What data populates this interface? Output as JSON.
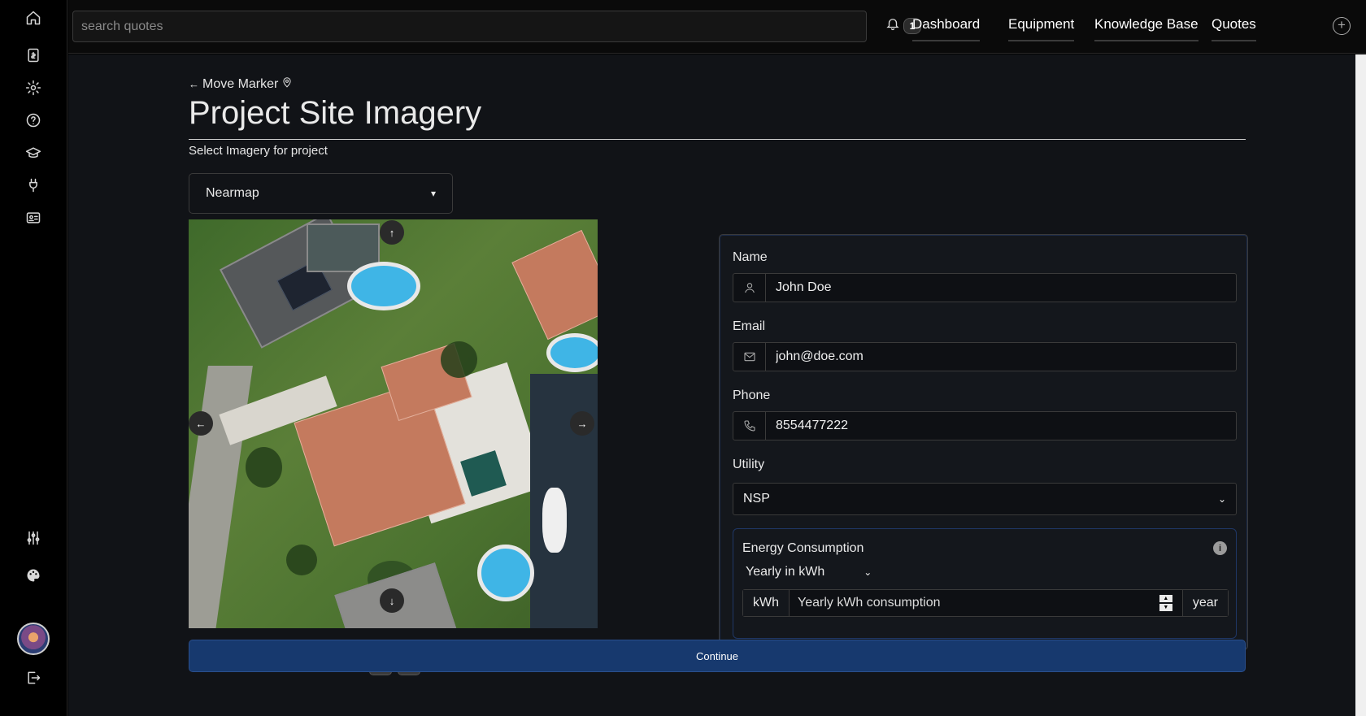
{
  "search": {
    "placeholder": "search quotes"
  },
  "notifications": {
    "count": "1"
  },
  "nav": {
    "items": [
      "Dashboard",
      "Equipment",
      "Knowledge Base",
      "Quotes"
    ]
  },
  "page": {
    "back_label": "Move Marker",
    "title": "Project Site Imagery",
    "subtitle": "Select Imagery for project",
    "imagery_source": "Nearmap",
    "continue_label": "Continue"
  },
  "form": {
    "name_label": "Name",
    "name_value": "John Doe",
    "email_label": "Email",
    "email_value": "john@doe.com",
    "phone_label": "Phone",
    "phone_value": "8554477222",
    "utility_label": "Utility",
    "utility_value": "NSP",
    "energy_title": "Energy Consumption",
    "energy_period": "Yearly in kWh",
    "energy_unit_left": "kWh",
    "energy_placeholder": "Yearly kWh consumption",
    "energy_unit_right": "year"
  },
  "colors": {
    "accent": "#17396e",
    "background": "#111317",
    "sidebar": "#000000"
  }
}
